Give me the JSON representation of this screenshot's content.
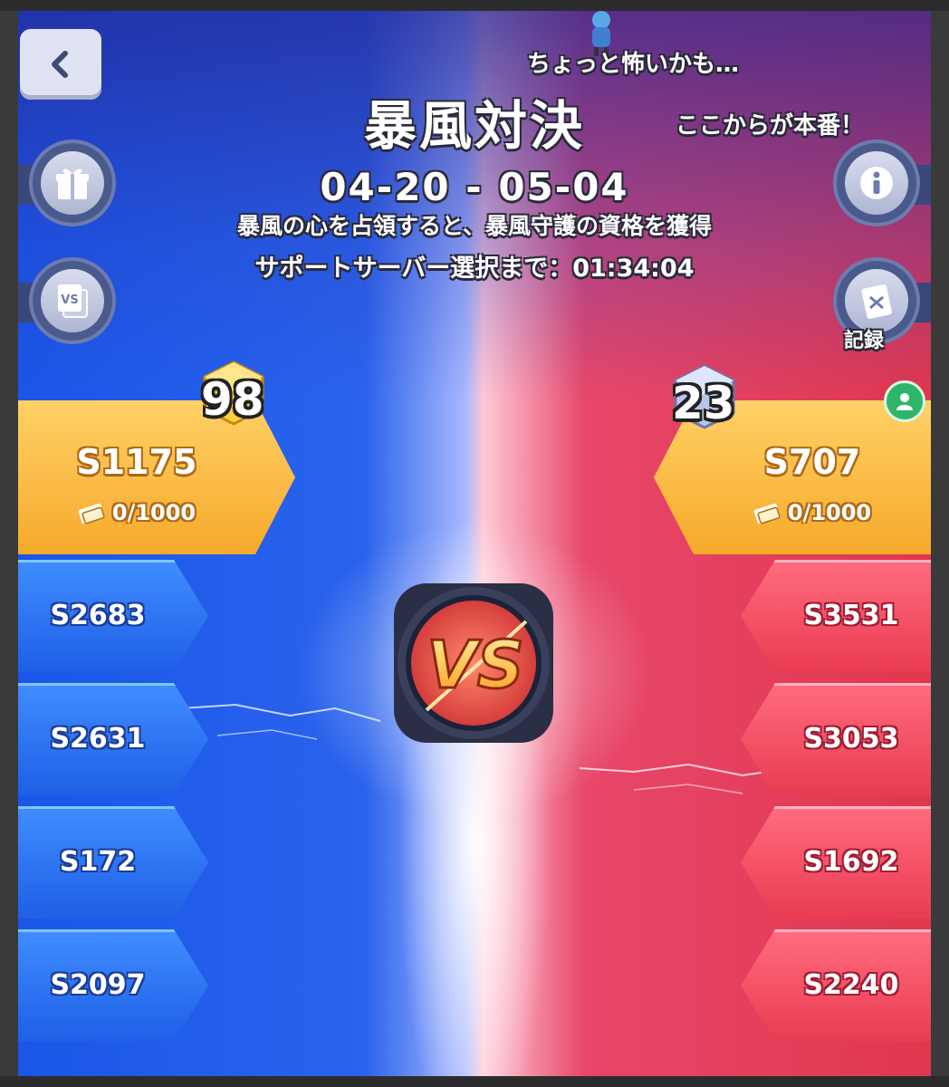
{
  "header": {
    "title": "暴風対決",
    "date_range": "04-20 - 05-04",
    "description": "暴風の心を占領すると、暴風守護の資格を獲得",
    "countdown_label": "サポートサーバー選択まで：",
    "countdown_value": "01:34:04"
  },
  "chat": {
    "message_1": "ちょっと怖いかも…",
    "message_2": "ここからが本番！"
  },
  "side_buttons": {
    "left": [
      "gift-icon",
      "vs-history-icon"
    ],
    "right": [
      "info-icon",
      "record-icon"
    ],
    "record_label": "記録"
  },
  "left_team": {
    "score": "98",
    "server": "S1175",
    "quota": "0/1000",
    "servers": [
      "S2683",
      "S2631",
      "S172",
      "S2097"
    ]
  },
  "right_team": {
    "score": "23",
    "server": "S707",
    "quota": "0/1000",
    "servers": [
      "S3531",
      "S3053",
      "S1692",
      "S2240"
    ]
  },
  "center": {
    "badge_text": "VS"
  },
  "colors": {
    "left_team": "#2a63ec",
    "right_team": "#e0374e",
    "highlight_card": "#f6a92b",
    "user_badge": "#2fb56a"
  }
}
